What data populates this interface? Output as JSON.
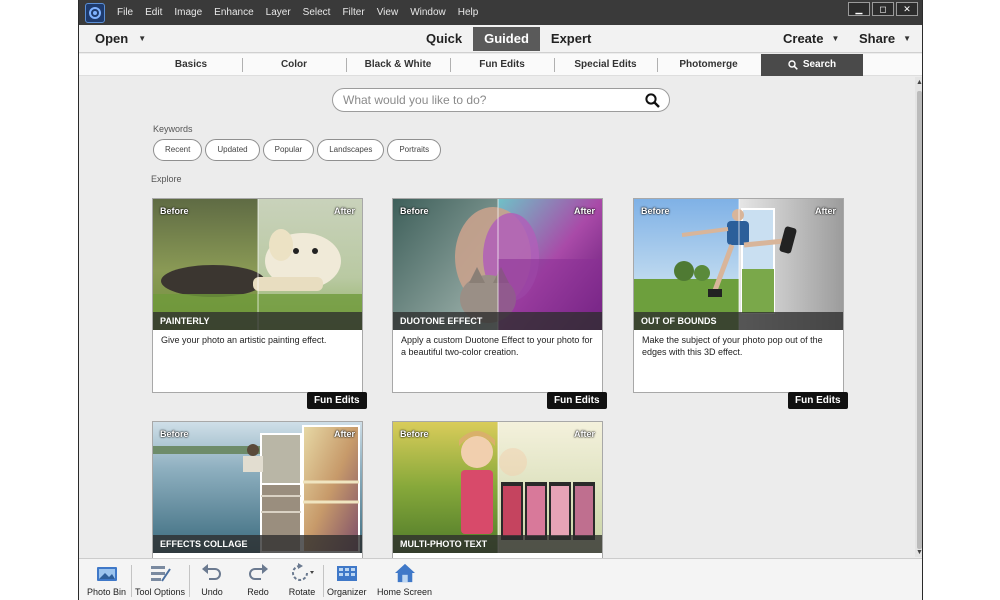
{
  "menubar": {
    "items": [
      "File",
      "Edit",
      "Image",
      "Enhance",
      "Layer",
      "Select",
      "Filter",
      "View",
      "Window",
      "Help"
    ],
    "window_controls": {
      "minimize": "▁",
      "maximize": "◻",
      "close": "✕"
    }
  },
  "modebar": {
    "open_label": "Open",
    "modes": [
      "Quick",
      "Guided",
      "Expert"
    ],
    "active_mode": "Guided",
    "create_label": "Create",
    "share_label": "Share",
    "caret": "▼"
  },
  "guided_tabs": {
    "tabs": [
      "Basics",
      "Color",
      "Black & White",
      "Fun Edits",
      "Special Edits",
      "Photomerge"
    ],
    "search_label": "Search"
  },
  "search": {
    "placeholder": "What would you like to do?",
    "value": ""
  },
  "keywords": {
    "label": "Keywords",
    "chips": [
      "Recent",
      "Updated",
      "Popular",
      "Landscapes",
      "Portraits"
    ]
  },
  "explore": {
    "label": "Explore"
  },
  "cards": [
    {
      "before": "Before",
      "after": "After",
      "title": "PAINTERLY",
      "description": "Give your photo an artistic painting effect.",
      "badge": "Fun Edits"
    },
    {
      "before": "Before",
      "after": "After",
      "title": "DUOTONE EFFECT",
      "description": "Apply a custom Duotone Effect to your photo for a beautiful two-color creation.",
      "badge": "Fun Edits"
    },
    {
      "before": "Before",
      "after": "After",
      "title": "OUT OF BOUNDS",
      "description": "Make the subject of your photo pop out of the edges with this 3D effect.",
      "badge": "Fun Edits"
    },
    {
      "before": "Before",
      "after": "After",
      "title": "EFFECTS COLLAGE",
      "description": "",
      "badge": ""
    },
    {
      "before": "Before",
      "after": "After",
      "title": "MULTI-PHOTO TEXT",
      "description": "",
      "badge": ""
    }
  ],
  "bottombar": {
    "tools": [
      "Photo Bin",
      "Tool Options",
      "Undo",
      "Redo",
      "Rotate",
      "Organizer",
      "Home Screen"
    ]
  },
  "colors": {
    "accent_blue": "#3f78c8",
    "active_tab": "#5a5a5a",
    "menubar": "#3a3a3a"
  }
}
